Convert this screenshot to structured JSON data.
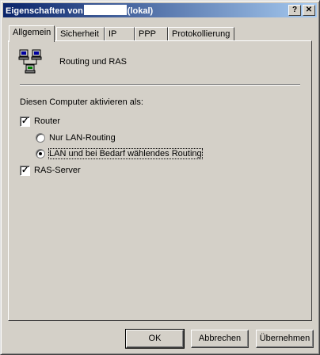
{
  "window": {
    "title_prefix": "Eigenschaften von",
    "title_suffix": "(lokal)",
    "help_btn": "?",
    "close_btn": "✕"
  },
  "tabs": [
    {
      "label": "Allgemein",
      "active": true
    },
    {
      "label": "Sicherheit"
    },
    {
      "label": "IP"
    },
    {
      "label": "PPP"
    },
    {
      "label": "Protokollierung"
    }
  ],
  "header": {
    "title": "Routing und RAS",
    "icon": "network-computers-icon"
  },
  "section": {
    "label": "Diesen Computer aktivieren als:"
  },
  "options": {
    "router": {
      "label": "Router",
      "checked": true
    },
    "lan_only": {
      "label": "Nur LAN-Routing",
      "selected": false
    },
    "lan_demand": {
      "label": "LAN und bei Bedarf wählendes Routing",
      "selected": true
    },
    "ras_server": {
      "label": "RAS-Server",
      "checked": true
    }
  },
  "buttons": {
    "ok": "OK",
    "cancel": "Abbrechen",
    "apply": "Übernehmen"
  }
}
